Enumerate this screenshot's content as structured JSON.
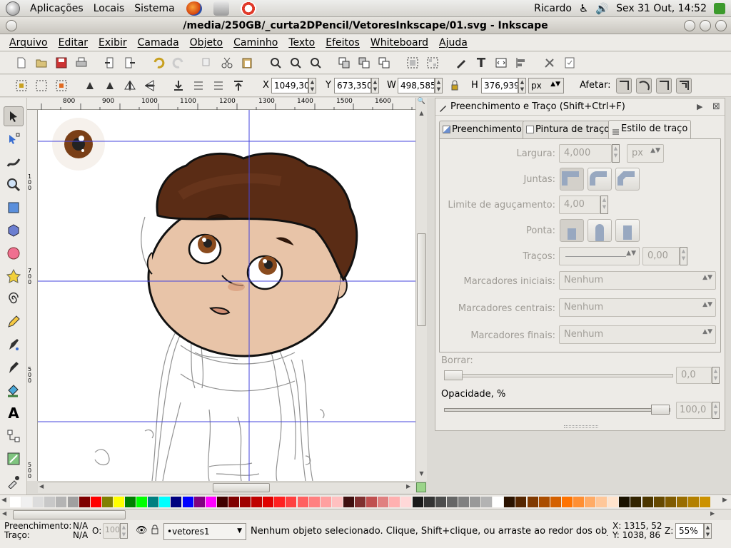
{
  "top_panel": {
    "menus": [
      "Aplicações",
      "Locais",
      "Sistema"
    ],
    "user": "Ricardo",
    "clock": "Sex 31 Out, 14:52"
  },
  "window": {
    "title": "/media/250GB/_curta2DPencil/VetoresInkscape/01.svg - Inkscape"
  },
  "menubar": [
    "Arquivo",
    "Editar",
    "Exibir",
    "Camada",
    "Objeto",
    "Caminho",
    "Texto",
    "Efeitos",
    "Whiteboard",
    "Ajuda"
  ],
  "controls": {
    "x_label": "X",
    "x_value": "1049,30",
    "y_label": "Y",
    "y_value": "673,350",
    "w_label": "W",
    "w_value": "498,585",
    "h_label": "H",
    "h_value": "376,939",
    "unit": "px",
    "affect_label": "Afetar:"
  },
  "ruler": {
    "ticks": [
      "800",
      "900",
      "1000",
      "1100",
      "1200",
      "1300",
      "1400",
      "1500",
      "1600"
    ],
    "vticks": [
      "100",
      "700",
      "500",
      "500"
    ]
  },
  "panel": {
    "title": "Preenchimento e Traço (Shift+Ctrl+F)",
    "tabs": [
      "Preenchimento",
      "Pintura de traço",
      "Estilo de traço"
    ],
    "width_label": "Largura:",
    "width_value": "4,000",
    "width_unit": "px",
    "joins_label": "Juntas:",
    "miter_label": "Limite de aguçamento:",
    "miter_value": "4,00",
    "cap_label": "Ponta:",
    "dashes_label": "Traços:",
    "dashes_value": "0,00",
    "start_markers_label": "Marcadores iniciais:",
    "start_markers_value": "Nenhum",
    "mid_markers_label": "Marcadores centrais:",
    "mid_markers_value": "Nenhum",
    "end_markers_label": "Marcadores finais:",
    "end_markers_value": "Nenhum",
    "blur_label": "Borrar:",
    "blur_value": "0,0",
    "opacity_label": "Opacidade, %",
    "opacity_value": "100,0"
  },
  "status": {
    "fill_label": "Preenchimento:",
    "fill_value": "N/A",
    "stroke_label": "Traço:",
    "stroke_value": "N/A",
    "o_label": "O:",
    "o_value": "100",
    "layer": "•vetores1",
    "message": "Nenhum objeto selecionado. Clique, Shift+clique, ou arraste ao redor dos obje",
    "cursor_x": "X: 1315, 52",
    "cursor_y": "Y: 1038, 86",
    "zoom_label": "Z:",
    "zoom_value": "55%"
  },
  "palette_colors": [
    "#ffffff",
    "#f0f0f0",
    "#dcdcdc",
    "#c8c8c8",
    "#b4b4b4",
    "#a0a0a0",
    "#7f0000",
    "#ff0000",
    "#808000",
    "#ffff00",
    "#008000",
    "#00ff00",
    "#008080",
    "#00ffff",
    "#000080",
    "#0000ff",
    "#800080",
    "#ff00ff",
    "#400000",
    "#800000",
    "#a00000",
    "#c00000",
    "#e00000",
    "#ff2020",
    "#ff4040",
    "#ff6060",
    "#ff8080",
    "#ffa0a0",
    "#ffc0c0",
    "#401010",
    "#803030",
    "#c05050",
    "#e08080",
    "#ffb0b0",
    "#ffd8d8",
    "#1a1a1a",
    "#333333",
    "#4d4d4d",
    "#666666",
    "#808080",
    "#999999",
    "#b3b3b3",
    "#ffffff",
    "#2b1300",
    "#552600",
    "#803900",
    "#aa4d00",
    "#d46000",
    "#ff7300",
    "#ff8f33",
    "#ffab66",
    "#ffc799",
    "#ffe3cc",
    "#1a1200",
    "#332400",
    "#4d3700",
    "#664900",
    "#805b00",
    "#996d00",
    "#b38000",
    "#cc9200"
  ]
}
